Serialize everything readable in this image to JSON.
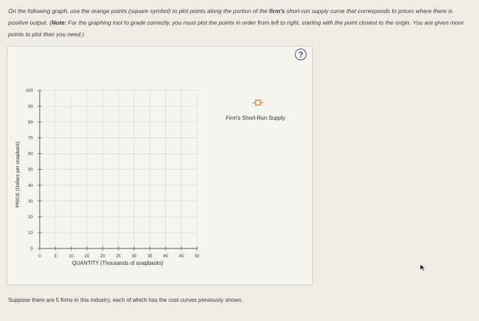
{
  "instructions": {
    "part1": "On the following graph, use the orange points (square symbol) to plot points along the portion of the ",
    "bold1": "firm's",
    "part2": " short-run supply curve that corresponds to prices where there is positive output. (",
    "bold2": "Note:",
    "part3": " For the graphing tool to grade correctly, you must plot the points in order from left to right, starting with the point closest to the origin. You are given more points to plot than you need.)"
  },
  "help_icon": "?",
  "legend": {
    "label": "Firm's Short-Run Supply",
    "marker_color": "#e07a2b"
  },
  "chart_data": {
    "type": "scatter",
    "xlabel": "QUANTITY (Thousands of snapbacks)",
    "ylabel": "PRICE (Dollars per snapback)",
    "xlim": [
      0,
      50
    ],
    "ylim": [
      0,
      100
    ],
    "xticks": [
      0,
      5,
      10,
      15,
      20,
      25,
      30,
      35,
      40,
      45,
      50
    ],
    "yticks": [
      0,
      10,
      20,
      30,
      40,
      50,
      60,
      70,
      80,
      90,
      100
    ],
    "grid": true,
    "series": []
  },
  "bottom_text": "Suppose there are 5 firms in this industry, each of which has the cost curves previously shown."
}
